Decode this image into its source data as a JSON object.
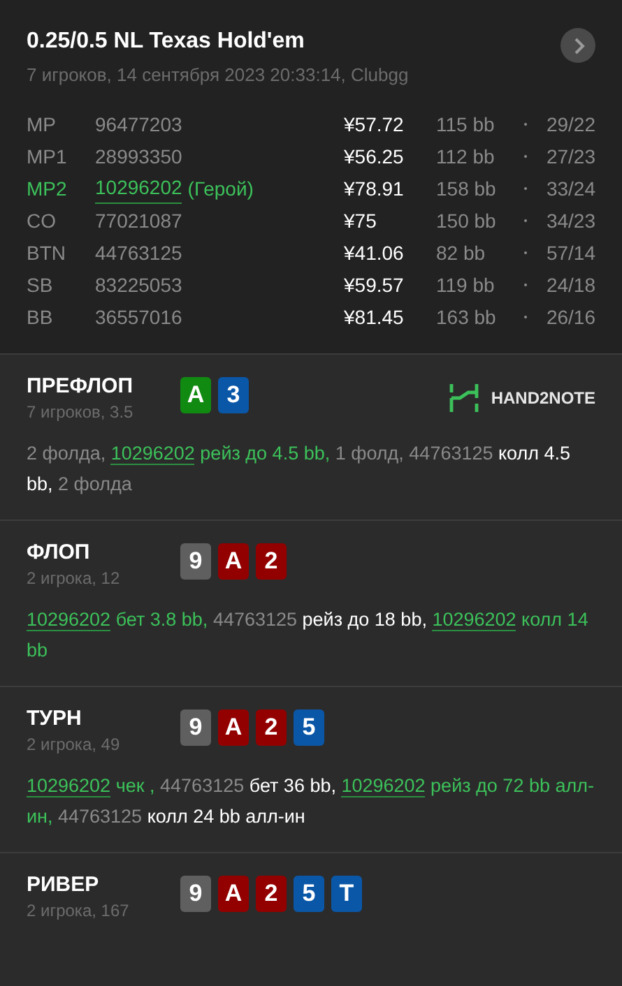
{
  "header": {
    "title": "0.25/0.5 NL Texas Hold'em",
    "subtitle": "7 игроков, 14 сентября 2023 20:33:14, Clubgg"
  },
  "players": [
    {
      "position": "MP",
      "id": "96477203",
      "hero": false,
      "stack": "¥57.72",
      "bb": "115 bb",
      "stats": "29/22"
    },
    {
      "position": "MP1",
      "id": "28993350",
      "hero": false,
      "stack": "¥56.25",
      "bb": "112 bb",
      "stats": "27/23"
    },
    {
      "position": "MP2",
      "id": "10296202",
      "hero": true,
      "hero_label": "(Герой)",
      "stack": "¥78.91",
      "bb": "158 bb",
      "stats": "33/24"
    },
    {
      "position": "CO",
      "id": "77021087",
      "hero": false,
      "stack": "¥75",
      "bb": "150 bb",
      "stats": "34/23"
    },
    {
      "position": "BTN",
      "id": "44763125",
      "hero": false,
      "stack": "¥41.06",
      "bb": "82 bb",
      "stats": "57/14"
    },
    {
      "position": "SB",
      "id": "83225053",
      "hero": false,
      "stack": "¥59.57",
      "bb": "119 bb",
      "stats": "24/18"
    },
    {
      "position": "BB",
      "id": "36557016",
      "hero": false,
      "stack": "¥81.45",
      "bb": "163 bb",
      "stats": "26/16"
    }
  ],
  "streets": [
    {
      "name": "ПРЕФЛОП",
      "info": "7 игроков, 3.5",
      "logo": "HAND2NOTE",
      "cards": [
        {
          "rank": "A",
          "color": "#118a11"
        },
        {
          "rank": "3",
          "color": "#0a57a8"
        }
      ],
      "actions": [
        {
          "kind": "muted",
          "text": "2 фолда, "
        },
        {
          "kind": "hero_link",
          "text": "10296202"
        },
        {
          "kind": "hero",
          "text": " рейз до 4.5 bb, "
        },
        {
          "kind": "muted",
          "text": "1 фолд, 44763125 "
        },
        {
          "kind": "villain",
          "text": "колл 4.5 bb, "
        },
        {
          "kind": "muted",
          "text": "2 фолда"
        }
      ]
    },
    {
      "name": "ФЛОП",
      "info": "2 игрока, 12",
      "cards": [
        {
          "rank": "9",
          "color": "#5f5f5f"
        },
        {
          "rank": "A",
          "color": "#930000"
        },
        {
          "rank": "2",
          "color": "#930000"
        }
      ],
      "actions": [
        {
          "kind": "hero_link",
          "text": "10296202"
        },
        {
          "kind": "hero",
          "text": " бет 3.8 bb, "
        },
        {
          "kind": "muted",
          "text": "44763125 "
        },
        {
          "kind": "villain",
          "text": "рейз до 18 bb, "
        },
        {
          "kind": "hero_link",
          "text": "10296202"
        },
        {
          "kind": "hero",
          "text": " колл 14 bb"
        }
      ]
    },
    {
      "name": "ТУРН",
      "info": "2 игрока, 49",
      "cards": [
        {
          "rank": "9",
          "color": "#5f5f5f"
        },
        {
          "rank": "A",
          "color": "#930000"
        },
        {
          "rank": "2",
          "color": "#930000"
        },
        {
          "rank": "5",
          "color": "#0a57a8"
        }
      ],
      "actions": [
        {
          "kind": "hero_link",
          "text": "10296202"
        },
        {
          "kind": "hero",
          "text": " чек , "
        },
        {
          "kind": "muted",
          "text": "44763125 "
        },
        {
          "kind": "villain",
          "text": "бет 36 bb, "
        },
        {
          "kind": "hero_link",
          "text": "10296202"
        },
        {
          "kind": "hero",
          "text": " рейз до 72 bb алл-ин, "
        },
        {
          "kind": "muted",
          "text": "44763125 "
        },
        {
          "kind": "villain",
          "text": "колл 24 bb алл-ин"
        }
      ]
    },
    {
      "name": "РИВЕР",
      "info": "2 игрока, 167",
      "cards": [
        {
          "rank": "9",
          "color": "#5f5f5f"
        },
        {
          "rank": "A",
          "color": "#930000"
        },
        {
          "rank": "2",
          "color": "#930000"
        },
        {
          "rank": "5",
          "color": "#0a57a8"
        },
        {
          "rank": "T",
          "color": "#0a57a8"
        }
      ]
    }
  ]
}
